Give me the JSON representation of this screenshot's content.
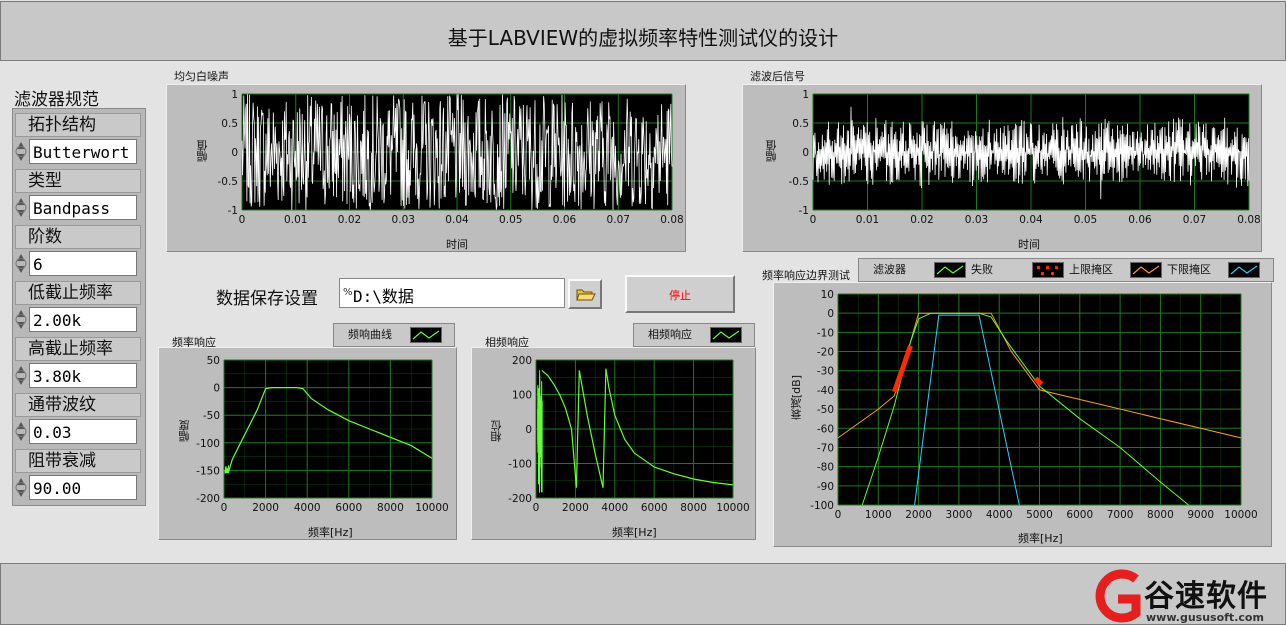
{
  "window": {
    "title": "基于LABVIEW的虚拟频率特性测试仪的设计"
  },
  "spec": {
    "heading": "滤波器规范",
    "fields": [
      {
        "label": "拓扑结构",
        "value": "Butterwort"
      },
      {
        "label": "类型",
        "value": "Bandpass"
      },
      {
        "label": "阶数",
        "value": "6"
      },
      {
        "label": "低截止频率",
        "value": "2.00k"
      },
      {
        "label": "高截止频率",
        "value": "3.80k"
      },
      {
        "label": "通带波纹",
        "value": "0.03"
      },
      {
        "label": "阻带衰减",
        "value": "90.00"
      }
    ]
  },
  "save": {
    "label": "数据保存设置",
    "path": "D:\\数据",
    "path_prefix": "%",
    "browse_icon": "folder-open-icon"
  },
  "stop_button": {
    "label": "停止",
    "color": "#ff0000"
  },
  "noise_plot": {
    "title": "均匀白噪声",
    "xlabel": "时间",
    "ylabel": "幅值"
  },
  "filtered_plot": {
    "title": "滤波后信号",
    "xlabel": "时间",
    "ylabel": "幅值"
  },
  "freq_plot": {
    "title": "频率响应",
    "legend": "频响曲线",
    "xlabel": "频率[Hz]",
    "ylabel": "幅度"
  },
  "phase_plot": {
    "title": "相频响应",
    "legend": "相频响应",
    "xlabel": "频率[Hz]",
    "ylabel": "相位"
  },
  "boundary_plot": {
    "title": "频率响应边界测试",
    "legend": [
      "滤波器",
      "失败",
      "上限掩区",
      "下限掩区"
    ],
    "xlabel": "频率[Hz]",
    "ylabel": "衰减[dB]"
  },
  "logo": {
    "text": "谷速软件",
    "url": "www.gususoft.com"
  },
  "colors": {
    "plot_bg": "#000000",
    "grid": "#1e7a1e",
    "trace": "#66ff33",
    "upper_mask": "#ff9933",
    "lower_mask": "#33ccff",
    "fail": "#ff2a00"
  },
  "chart_data": [
    {
      "type": "line",
      "title": "均匀白噪声",
      "xlabel": "时间",
      "ylabel": "幅值",
      "xlim": [
        0,
        0.08
      ],
      "ylim": [
        -1,
        1
      ],
      "xticks": [
        "0",
        "0.01",
        "0.02",
        "0.03",
        "0.04",
        "0.05",
        "0.06",
        "0.07",
        "0.08"
      ],
      "yticks": [
        "1",
        "0.5",
        "0",
        "-0.5",
        "-1"
      ],
      "series": [
        {
          "description": "uniform white noise between -1 and 1",
          "amplitude": 1.0
        }
      ]
    },
    {
      "type": "line",
      "title": "滤波后信号",
      "xlabel": "时间",
      "ylabel": "幅值",
      "xlim": [
        0,
        0.08
      ],
      "ylim": [
        -1,
        1
      ],
      "xticks": [
        "0",
        "0.01",
        "0.02",
        "0.03",
        "0.04",
        "0.05",
        "0.06",
        "0.07",
        "0.08"
      ],
      "yticks": [
        "1",
        "0.5",
        "0",
        "-0.5",
        "-1"
      ],
      "series": [
        {
          "description": "band-passed noise",
          "amplitude": 0.55
        }
      ]
    },
    {
      "type": "line",
      "title": "频率响应",
      "xlabel": "频率[Hz]",
      "ylabel": "幅度",
      "xlim": [
        0,
        10000
      ],
      "ylim": [
        -200,
        50
      ],
      "xticks": [
        "0",
        "2000",
        "4000",
        "6000",
        "8000",
        "10000"
      ],
      "yticks": [
        "50",
        "0",
        "-50",
        "-100",
        "-150",
        "-200"
      ],
      "series": [
        {
          "name": "频响曲线",
          "x": [
            200,
            400,
            800,
            1200,
            1600,
            2000,
            2300,
            3500,
            3800,
            4200,
            5000,
            6000,
            7000,
            8000,
            9000,
            10000
          ],
          "y": [
            -155,
            -130,
            -100,
            -70,
            -40,
            -2,
            0,
            0,
            -2,
            -20,
            -40,
            -60,
            -75,
            -90,
            -105,
            -128
          ]
        }
      ]
    },
    {
      "type": "line",
      "title": "相频响应",
      "xlabel": "频率[Hz]",
      "ylabel": "相位",
      "xlim": [
        0,
        10000
      ],
      "ylim": [
        -200,
        200
      ],
      "xticks": [
        "0",
        "2000",
        "4000",
        "6000",
        "8000",
        "10000"
      ],
      "yticks": [
        "200",
        "100",
        "0",
        "-100",
        "-200"
      ],
      "series": [
        {
          "name": "相频响应",
          "x": [
            300,
            600,
            900,
            1200,
            1500,
            1800,
            2050,
            2200,
            2600,
            3000,
            3400,
            3550,
            3700,
            4000,
            4500,
            5000,
            6000,
            7000,
            8000,
            9000,
            10000
          ],
          "y": [
            170,
            155,
            130,
            100,
            60,
            0,
            -170,
            170,
            40,
            -70,
            -170,
            175,
            120,
            40,
            -30,
            -70,
            -110,
            -130,
            -145,
            -155,
            -162
          ]
        }
      ]
    },
    {
      "type": "line",
      "title": "频率响应边界测试",
      "xlabel": "频率[Hz]",
      "ylabel": "衰减[dB]",
      "xlim": [
        0,
        10000
      ],
      "ylim": [
        -100,
        10
      ],
      "xticks": [
        "0",
        "1000",
        "2000",
        "3000",
        "4000",
        "5000",
        "6000",
        "7000",
        "8000",
        "9000",
        "10000"
      ],
      "yticks": [
        "10",
        "0",
        "-10",
        "-20",
        "-30",
        "-40",
        "-50",
        "-60",
        "-70",
        "-80",
        "-90",
        "-100"
      ],
      "series": [
        {
          "name": "滤波器",
          "x": [
            600,
            1000,
            1400,
            1800,
            2000,
            2300,
            3500,
            3800,
            4200,
            5000,
            6000,
            7000,
            8000,
            8700
          ],
          "y": [
            -100,
            -75,
            -48,
            -15,
            -3,
            0,
            0,
            -2,
            -15,
            -38,
            -55,
            -70,
            -88,
            -100
          ]
        },
        {
          "name": "上限掩区",
          "x": [
            0,
            1000,
            1400,
            1800,
            2000,
            3800,
            4300,
            5000,
            10000
          ],
          "y": [
            -65,
            -50,
            -43,
            -15,
            0,
            0,
            -20,
            -40,
            -65
          ]
        },
        {
          "name": "下限掩区",
          "x": [
            1900,
            2500,
            3500,
            4500
          ],
          "y": [
            -100,
            -1,
            -1,
            -100
          ]
        },
        {
          "name": "失败",
          "x": [
            1400,
            1450,
            1500,
            1550,
            1600,
            1650,
            1700,
            1750,
            1800,
            4900,
            4950,
            5000,
            5050
          ],
          "y": [
            -41,
            -38,
            -35,
            -32,
            -29,
            -26,
            -23,
            -20,
            -17,
            -34,
            -35,
            -36,
            -37
          ]
        }
      ]
    }
  ]
}
